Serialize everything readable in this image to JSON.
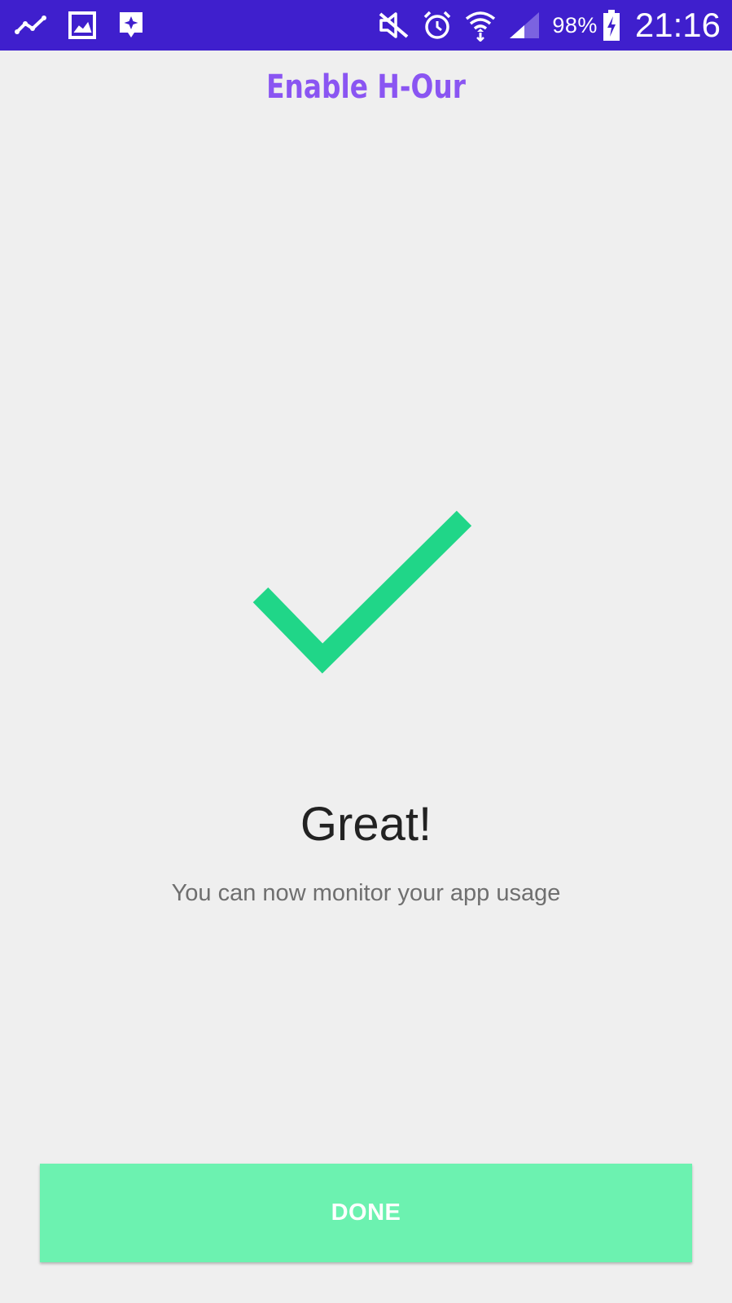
{
  "status_bar": {
    "left_icons": [
      "activity-chart-icon",
      "gallery-image-icon",
      "sparkle-message-icon"
    ],
    "right_icons": [
      "mute-icon",
      "alarm-icon",
      "wifi-icon",
      "signal-icon",
      "battery-charging-icon"
    ],
    "battery_percent": "98%",
    "time": "21:16"
  },
  "header": {
    "title": "Enable H-Our"
  },
  "main": {
    "success_icon": "check-mark-icon",
    "success_title": "Great!",
    "success_message": "You can now monitor your app usage"
  },
  "footer": {
    "done_label": "DONE"
  },
  "colors": {
    "status_bar": "#3f1fcd",
    "title_accent": "#8a55f2",
    "check_mark": "#20d688",
    "button_background": "#6cf2b0",
    "page_background": "#efefef"
  }
}
